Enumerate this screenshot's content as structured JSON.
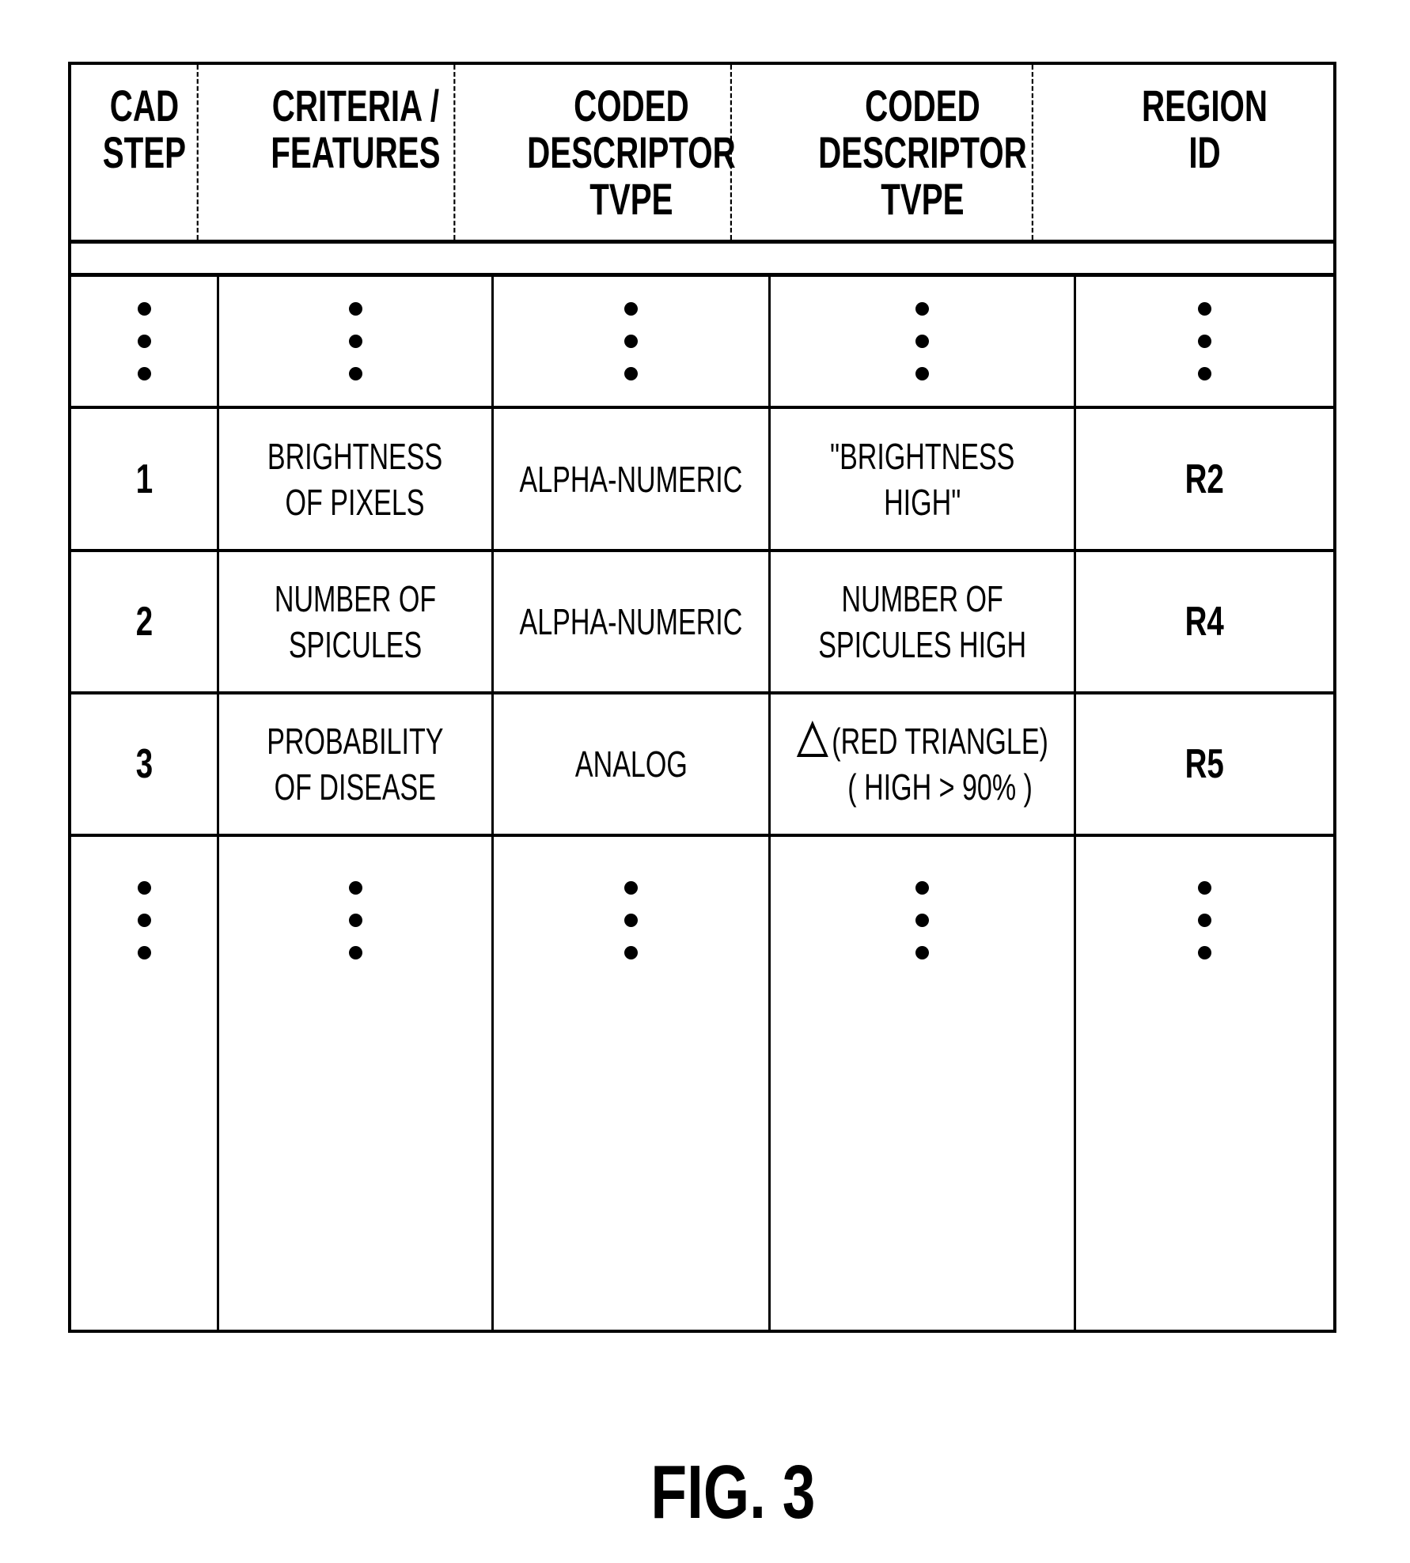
{
  "table": {
    "headers": [
      [
        "CAD",
        "STEP"
      ],
      [
        "CRITERIA /",
        "FEATURES"
      ],
      [
        "CODED",
        "DESCRIPTOR",
        "TVPE"
      ],
      [
        "CODED",
        "DESCRIPTOR",
        "TVPE"
      ],
      [
        "REGION",
        "ID"
      ]
    ],
    "rows": [
      {
        "cad_step": "1",
        "criteria": [
          "BRIGHTNESS",
          "OF PIXELS"
        ],
        "descriptor_type": "ALPHA-NUMERIC",
        "descriptor": [
          "\"BRIGHTNESS",
          "HIGH\""
        ],
        "region_id": "R2"
      },
      {
        "cad_step": "2",
        "criteria": [
          "NUMBER OF",
          "SPICULES"
        ],
        "descriptor_type": "ALPHA-NUMERIC",
        "descriptor": [
          "NUMBER OF",
          "SPICULES HIGH"
        ],
        "region_id": "R4"
      },
      {
        "cad_step": "3",
        "criteria": [
          "PROBABILITY",
          "OF DISEASE"
        ],
        "descriptor_type": "ANALOG",
        "descriptor_icon": "triangle-outline-icon",
        "descriptor": [
          "(RED TRIANGLE)",
          "( HIGH > 90% )"
        ],
        "region_id": "R5"
      }
    ],
    "continuation_marker": "ellipsis-vertical"
  },
  "caption": "FIG. 3"
}
